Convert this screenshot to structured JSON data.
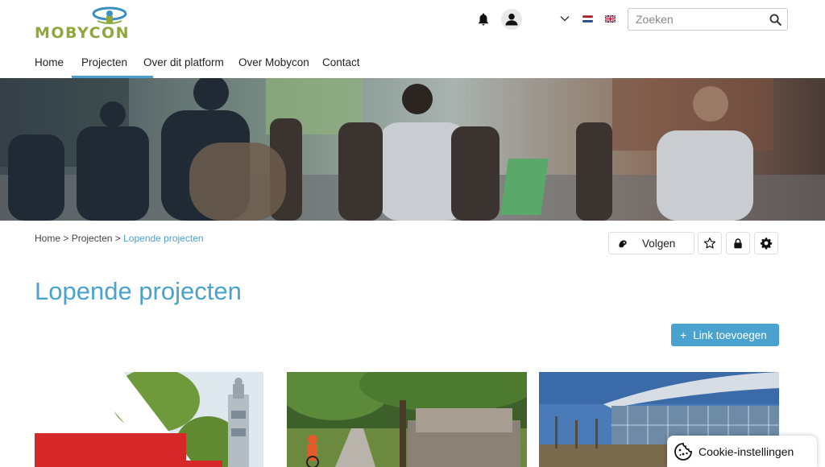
{
  "brand": {
    "name": "MOBYCON",
    "color": "#8fa83e"
  },
  "colors": {
    "accent": "#4aa3cf",
    "logo_blue": "#3b8fc2"
  },
  "header": {
    "icons": [
      "bell-icon",
      "user-avatar-icon",
      "chevron-down-icon"
    ],
    "languages": [
      "nl-flag",
      "en-flag"
    ],
    "search": {
      "placeholder": "Zoeken",
      "icon": "search-icon"
    }
  },
  "nav": {
    "items": [
      {
        "label": "Home",
        "active": false
      },
      {
        "label": "Projecten",
        "active": true
      },
      {
        "label": "Over dit platform",
        "active": false
      },
      {
        "label": "Over Mobycon",
        "active": false
      },
      {
        "label": "Contact",
        "active": false
      }
    ]
  },
  "breadcrumb": {
    "home": "Home",
    "sep1": ">",
    "projecten": "Projecten",
    "sep2": ">",
    "current": "Lopende projecten"
  },
  "actions": {
    "follow_label": "Volgen",
    "icons": [
      "follow-icon",
      "star-icon",
      "lock-icon",
      "gear-icon"
    ]
  },
  "page": {
    "title": "Lopende projecten",
    "add_link_plus": "+",
    "add_link_label": "Link toevoegen"
  },
  "cookie": {
    "label": "Cookie-instellingen",
    "icon": "cookie-icon"
  }
}
